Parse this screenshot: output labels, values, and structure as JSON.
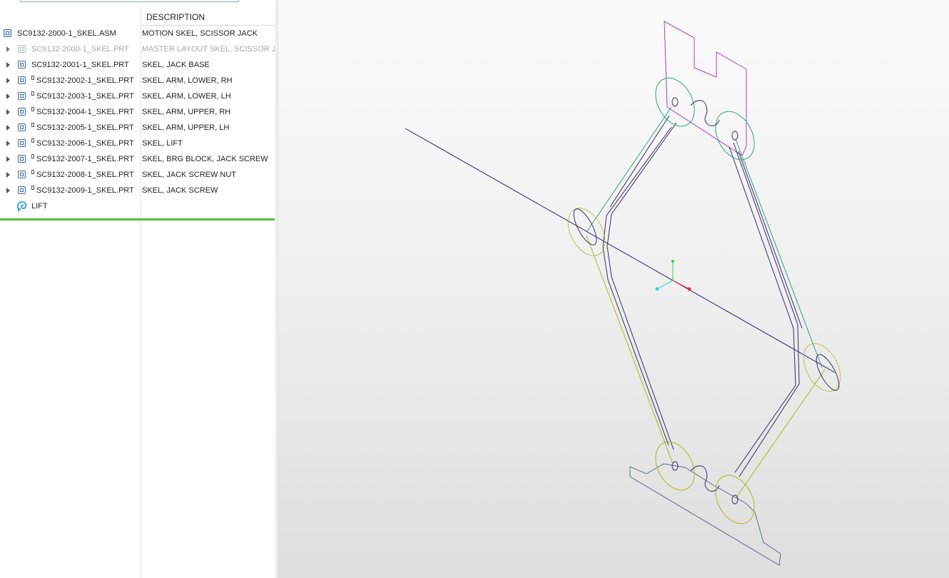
{
  "tree": {
    "column_header": "DESCRIPTION",
    "rows": [
      {
        "name": "SC9132-2000-1_SKEL.ASM",
        "description": "MOTION SKEL, SCISSOR JACK",
        "icon": "assembly-icon",
        "expandable": false,
        "dimmed": false
      },
      {
        "name": "SC9132-2000-1_SKEL.PRT",
        "description": "MASTER LAYOUT SKEL, SCISSOR JACK",
        "icon": "skeleton-part-icon",
        "expandable": true,
        "dimmed": true
      },
      {
        "name": "SC9132-2001-1_SKEL.PRT",
        "description": "SKEL, JACK BASE",
        "icon": "skeleton-part-icon",
        "expandable": true,
        "dimmed": false
      },
      {
        "name": "SC9132-2002-1_SKEL.PRT",
        "description": "SKEL, ARM, LOWER, RH",
        "icon": "skeleton-part-icon",
        "expandable": true,
        "dimmed": false
      },
      {
        "name": "SC9132-2003-1_SKEL.PRT",
        "description": "SKEL, ARM, LOWER, LH",
        "icon": "skeleton-part-icon",
        "expandable": true,
        "dimmed": false
      },
      {
        "name": "SC9132-2004-1_SKEL.PRT",
        "description": "SKEL, ARM, UPPER, RH",
        "icon": "skeleton-part-icon",
        "expandable": true,
        "dimmed": false
      },
      {
        "name": "SC9132-2005-1_SKEL.PRT",
        "description": "SKEL, ARM, UPPER, LH",
        "icon": "skeleton-part-icon",
        "expandable": true,
        "dimmed": false
      },
      {
        "name": "SC9132-2006-1_SKEL.PRT",
        "description": "SKEL, LIFT",
        "icon": "skeleton-part-icon",
        "expandable": true,
        "dimmed": false
      },
      {
        "name": "SC9132-2007-1_SKEL.PRT",
        "description": "SKEL, BRG BLOCK, JACK SCREW",
        "icon": "skeleton-part-icon",
        "expandable": true,
        "dimmed": false
      },
      {
        "name": "SC9132-2008-1_SKEL.PRT",
        "description": "SKEL, JACK SCREW NUT",
        "icon": "skeleton-part-icon",
        "expandable": true,
        "dimmed": false
      },
      {
        "name": "SC9132-2009-1_SKEL.PRT",
        "description": "SKEL, JACK SCREW",
        "icon": "skeleton-part-icon",
        "expandable": true,
        "dimmed": false
      },
      {
        "name": "LIFT",
        "description": "",
        "icon": "motion-snapshot-icon",
        "expandable": false,
        "dimmed": false
      }
    ]
  },
  "colors": {
    "insert_marker": "#4fc23a",
    "upper_arms": "#2aa57a",
    "lower_arms": "#b5b21c",
    "lift": "#a13fd0",
    "frame": "#3a2a6a",
    "jack_screw_axis": "#2d1f6e",
    "base": "#5d6b8a",
    "axis_x": "#e53030",
    "axis_y": "#2fd34a",
    "axis_z": "#30d8e0"
  }
}
